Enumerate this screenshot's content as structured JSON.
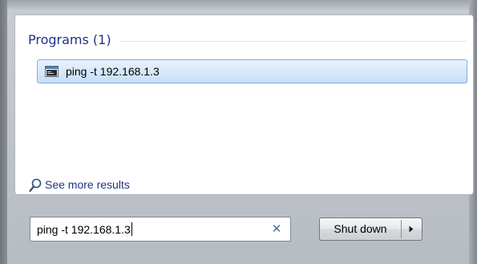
{
  "programs_section": {
    "title": "Programs (1)"
  },
  "results": [
    {
      "label": "ping -t 192.168.1.3",
      "icon": "console-program-icon"
    }
  ],
  "see_more": {
    "label": "See more results",
    "icon": "search-icon"
  },
  "search": {
    "value": "ping -t 192.168.1.3",
    "clear_icon": "clear-icon"
  },
  "shutdown": {
    "label": "Shut down",
    "arrow_icon": "chevron-right-icon"
  },
  "colors": {
    "heading": "#1e3287",
    "highlight_border": "#84acdd",
    "highlight_fill": "#c8dff8"
  }
}
